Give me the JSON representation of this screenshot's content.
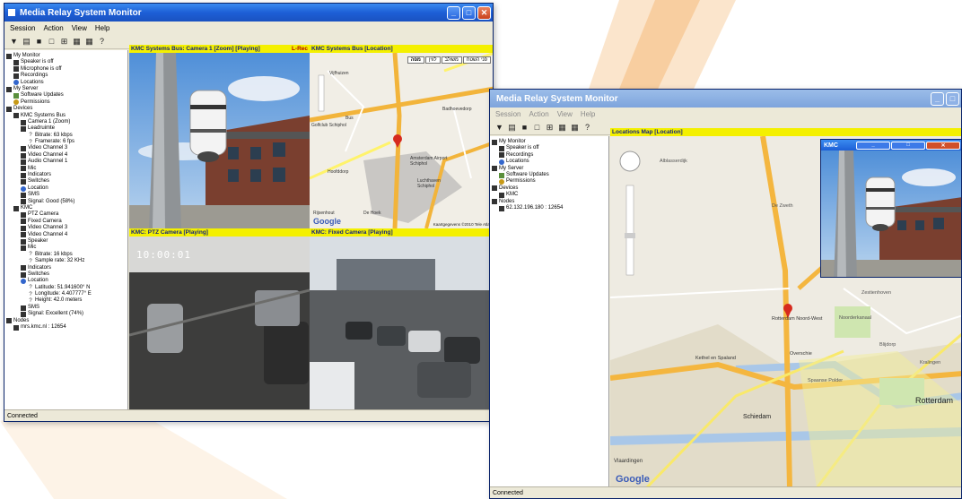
{
  "back_window": {
    "title": "Media Relay System Monitor",
    "menu": [
      "Session",
      "Action",
      "View",
      "Help"
    ],
    "tree": [
      {
        "indent": 0,
        "label": "My Monitor",
        "icon": "monitor-icon"
      },
      {
        "indent": 1,
        "label": "Speaker is off",
        "icon": "speaker-icon"
      },
      {
        "indent": 1,
        "label": "Microphone is off",
        "icon": "microphone-icon"
      },
      {
        "indent": 1,
        "label": "Recordings",
        "icon": "recordings-icon"
      },
      {
        "indent": 1,
        "label": "Locations",
        "icon": "globe-icon"
      },
      {
        "indent": 0,
        "label": "My Server",
        "icon": "server-icon"
      },
      {
        "indent": 1,
        "label": "Software Updates",
        "icon": "update-icon"
      },
      {
        "indent": 1,
        "label": "Permissions",
        "icon": "key-icon"
      },
      {
        "indent": 0,
        "label": "Devices",
        "icon": "devices-icon"
      },
      {
        "indent": 1,
        "label": "KMC Systems Bus",
        "icon": "device-icon"
      },
      {
        "indent": 2,
        "label": "Camera 1 (Zoom)",
        "icon": "camera-icon"
      },
      {
        "indent": 2,
        "label": "Leadruimte",
        "icon": "camera-icon"
      },
      {
        "indent": 3,
        "label": "Bitrate: 63 kbps",
        "icon": "info-icon"
      },
      {
        "indent": 3,
        "label": "Framerate: 6 fps",
        "icon": "info-icon"
      },
      {
        "indent": 2,
        "label": "Video Channel 3",
        "icon": "camera-icon"
      },
      {
        "indent": 2,
        "label": "Video Channel 4",
        "icon": "camera-icon"
      },
      {
        "indent": 2,
        "label": "Audio Channel 1",
        "icon": "audio-icon"
      },
      {
        "indent": 2,
        "label": "Mic",
        "icon": "microphone-icon"
      },
      {
        "indent": 2,
        "label": "Indicators",
        "icon": "indicator-icon"
      },
      {
        "indent": 2,
        "label": "Switches",
        "icon": "switch-icon"
      },
      {
        "indent": 2,
        "label": "Location",
        "icon": "globe-icon"
      },
      {
        "indent": 2,
        "label": "SMS",
        "icon": "sms-icon"
      },
      {
        "indent": 2,
        "label": "Signal: Good (58%)",
        "icon": "signal-icon"
      },
      {
        "indent": 1,
        "label": "KMC",
        "icon": "device-icon"
      },
      {
        "indent": 2,
        "label": "PTZ Camera",
        "icon": "camera-icon"
      },
      {
        "indent": 2,
        "label": "Fixed Camera",
        "icon": "camera-icon"
      },
      {
        "indent": 2,
        "label": "Video Channel 3",
        "icon": "camera-icon"
      },
      {
        "indent": 2,
        "label": "Video Channel 4",
        "icon": "camera-icon"
      },
      {
        "indent": 2,
        "label": "Speaker",
        "icon": "speaker-icon"
      },
      {
        "indent": 2,
        "label": "Mic",
        "icon": "microphone-icon"
      },
      {
        "indent": 3,
        "label": "Bitrate: 16 kbps",
        "icon": "info-icon"
      },
      {
        "indent": 3,
        "label": "Sample rate: 32 KHz",
        "icon": "info-icon"
      },
      {
        "indent": 2,
        "label": "Indicators",
        "icon": "indicator-icon"
      },
      {
        "indent": 2,
        "label": "Switches",
        "icon": "switch-icon"
      },
      {
        "indent": 2,
        "label": "Location",
        "icon": "globe-icon"
      },
      {
        "indent": 3,
        "label": "Latitude: 51.941600° N",
        "icon": "info-icon"
      },
      {
        "indent": 3,
        "label": "Longitude: 4.407777° E",
        "icon": "info-icon"
      },
      {
        "indent": 3,
        "label": "Height: 42.0 meters",
        "icon": "info-icon"
      },
      {
        "indent": 2,
        "label": "SMS",
        "icon": "sms-icon"
      },
      {
        "indent": 2,
        "label": "Signal: Excellent (74%)",
        "icon": "signal-icon"
      },
      {
        "indent": 0,
        "label": "Nodes",
        "icon": "nodes-icon"
      },
      {
        "indent": 1,
        "label": "mrs.kmc.nl : 12654",
        "icon": "node-icon"
      }
    ],
    "panels": {
      "camera1": {
        "header": "KMC Systems Bus: Camera 1 [Zoom] [Playing]",
        "badge": "L-Rec"
      },
      "location": {
        "header": "KMC Systems Bus [Location]"
      },
      "ptz": {
        "header": "KMC: PTZ Camera [Playing]",
        "overlay": "10:00:01"
      },
      "fixed": {
        "header": "KMC: Fixed Camera [Playing]"
      }
    },
    "map_tabs": [
      "מפה",
      "לווין",
      "משולב",
      "פני השטח"
    ],
    "map_labels": [
      "Vijfhuizen",
      "Bus",
      "Golfclub Schiphol",
      "Badhoevedorp",
      "Hoofddorp",
      "Amsterdam Airport Schiphol",
      "Luchthaven Schiphol",
      "Rijsenhout",
      "De Hoek"
    ],
    "map_copyright": "Kaartgegevens ©2010 Tele Atlas",
    "google": "Google",
    "status": "Connected"
  },
  "front_window": {
    "title": "Media Relay System Monitor",
    "menu": [
      "Session",
      "Action",
      "View",
      "Help"
    ],
    "tree": [
      {
        "indent": 0,
        "label": "My Monitor",
        "icon": "monitor-icon"
      },
      {
        "indent": 1,
        "label": "Speaker is off",
        "icon": "speaker-icon"
      },
      {
        "indent": 1,
        "label": "Recordings",
        "icon": "recordings-icon"
      },
      {
        "indent": 1,
        "label": "Locations",
        "icon": "globe-icon"
      },
      {
        "indent": 0,
        "label": "My Server",
        "icon": "server-icon"
      },
      {
        "indent": 1,
        "label": "Software Updates",
        "icon": "update-icon"
      },
      {
        "indent": 1,
        "label": "Permissions",
        "icon": "key-icon"
      },
      {
        "indent": 0,
        "label": "Devices",
        "icon": "devices-icon"
      },
      {
        "indent": 1,
        "label": "KMC",
        "icon": "device-icon"
      },
      {
        "indent": 0,
        "label": "Nodes",
        "icon": "nodes-icon"
      },
      {
        "indent": 1,
        "label": "62.132.196.180 : 12654",
        "icon": "node-icon"
      }
    ],
    "map_header": "Locations Map [Location]",
    "map_labels": [
      "Alblasserdijk",
      "De Zweth",
      "Rotterdam Noord-West",
      "Overschie",
      "Kethel en Spaland",
      "Schiedam",
      "Rotterdam",
      "Vlaardingen",
      "Noorderkanaal",
      "Spaanse Polder",
      "Zestienhoven",
      "Blijdorp",
      "Kralingen"
    ],
    "google": "Google",
    "popup_title": "KMC",
    "status": "Connected"
  }
}
